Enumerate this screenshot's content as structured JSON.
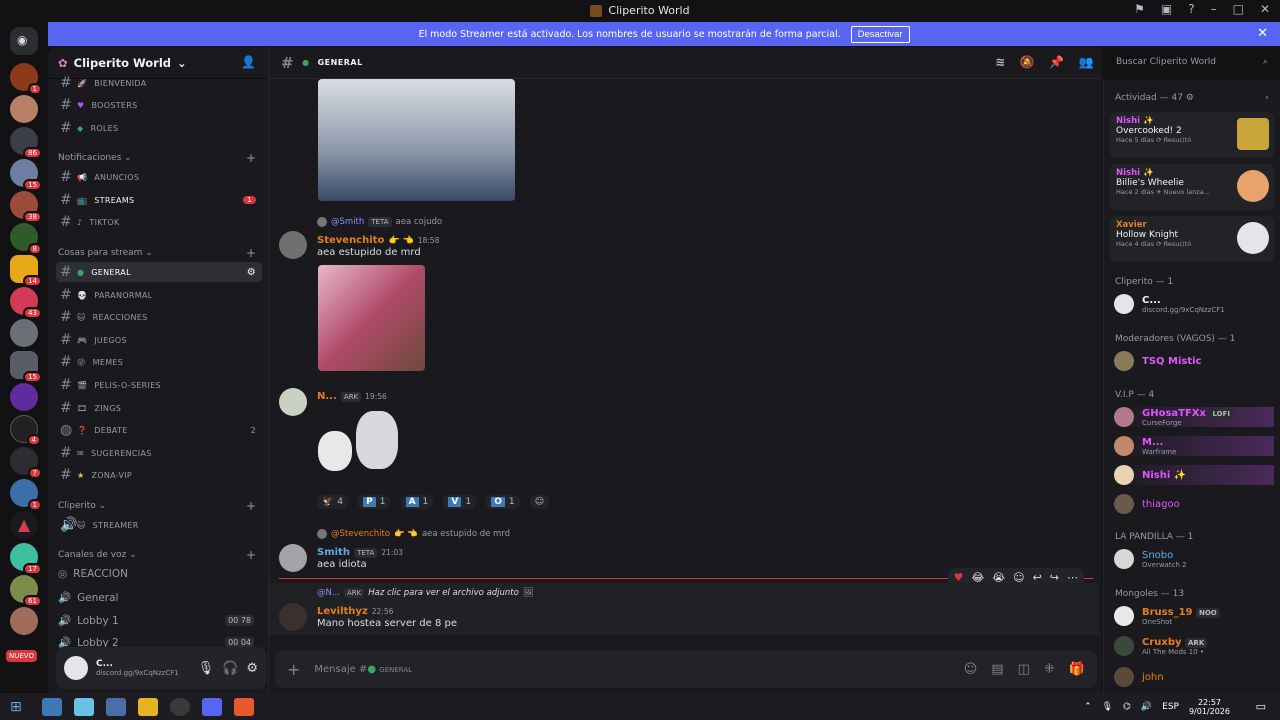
{
  "window": {
    "title": "Cliperito World"
  },
  "banner": {
    "text": "El modo Streamer está activado. Los nombres de usuario se mostrarán de forma parcial.",
    "button": "Desactivar"
  },
  "guilds": {
    "badges": [
      "1",
      "86",
      "15",
      "38",
      "8",
      "14",
      "43",
      "15",
      "4",
      "7",
      "1",
      "17",
      "61"
    ],
    "new_label": "NUEVO"
  },
  "server": {
    "name": "Cliperito World"
  },
  "channels": {
    "top": [
      {
        "name": "BIENVENIDA"
      },
      {
        "name": "BOOSTERS"
      },
      {
        "name": "ROLES"
      }
    ],
    "cat_notif": "Notificaciones",
    "notif": [
      {
        "name": "ANUNCIOS"
      },
      {
        "name": "STREAMS",
        "badge": "1"
      },
      {
        "name": "TIKTOK"
      }
    ],
    "cat_stream": "Cosas para stream",
    "stream": [
      {
        "name": "GENERAL"
      },
      {
        "name": "PARANORMAL"
      },
      {
        "name": "REACCIONES"
      },
      {
        "name": "JUEGOS"
      },
      {
        "name": "MEMES"
      },
      {
        "name": "PELIS-O-SERIES"
      },
      {
        "name": "ZINGS"
      },
      {
        "name": "DEBATE",
        "count": "2"
      },
      {
        "name": "SUGERENCIAS"
      },
      {
        "name": "ZONA-VIP"
      }
    ],
    "cat_cliperito": "Cliperito",
    "cliperito": [
      {
        "name": "STREAMER"
      }
    ],
    "cat_voice": "Canales de voz",
    "voice": [
      {
        "name": "REACCION"
      },
      {
        "name": "General"
      },
      {
        "name": "Lobby 1",
        "a": "00",
        "b": "78"
      },
      {
        "name": "Lobby 2",
        "a": "00",
        "b": "04"
      }
    ]
  },
  "user": {
    "name": "C...",
    "status": "discord.gg/9xCqNzzCF1"
  },
  "chat": {
    "channel": "GENERAL",
    "messages": {
      "m1": {
        "reply_name": "@Smith",
        "reply_tag": "TETA",
        "reply_text": "aea cojudo",
        "name": "Stevenchito",
        "emoji": "👉 👈",
        "time": "18:58",
        "text": "aea estupido de mrd"
      },
      "m2": {
        "name": "N...",
        "tag": "ARK",
        "time": "19:56"
      },
      "reactions": [
        {
          "label": "4"
        },
        {
          "key": "P",
          "label": "1"
        },
        {
          "key": "A",
          "label": "1"
        },
        {
          "key": "V",
          "label": "1"
        },
        {
          "key": "O",
          "label": "1"
        }
      ],
      "m3": {
        "reply_name": "@Stevenchito",
        "reply_emoji": "👉 👈",
        "reply_text": "aea estupido de mrd",
        "name": "Smith",
        "tag": "TETA",
        "time": "21:03",
        "text": "aea idiota"
      },
      "m4": {
        "reply_name": "@N...",
        "reply_tag": "ARK",
        "reply_text": "Haz clic para ver el archivo adjunto",
        "name": "Levilthyz",
        "time": "22:56",
        "text": "Mano hostea server de 8 pe"
      }
    },
    "composer_placeholder": "Mensaje #",
    "composer_channel": "GENERAL"
  },
  "search": {
    "placeholder": "Buscar Cliperito World"
  },
  "members": {
    "activity_title": "Actividad — 47",
    "activities": [
      {
        "user": "Nishi ✨",
        "game": "Overcooked! 2",
        "meta": "Hace 5 días",
        "meta2": "Resucitó"
      },
      {
        "user": "Nishi ✨",
        "game": "Billie's Wheelie",
        "meta": "Hace 2 días",
        "meta2": "Nuevo lanza..."
      },
      {
        "user": "Xavier",
        "game": "Hollow Knight",
        "meta": "Hace 4 días",
        "meta2": "Resucitó"
      }
    ],
    "groups": {
      "cliperito": "Cliperito — 1",
      "mods": "Moderadores (VAGOS) — 1",
      "vip": "V.I.P — 4",
      "pandilla": "LA PANDILLA — 1",
      "mongoles": "Mongoles — 13"
    },
    "list": {
      "c": {
        "name": "C...",
        "sub": "discord.gg/9xCqNzzCF1"
      },
      "tsq": {
        "name": "TSQ Mistic"
      },
      "ghosa": {
        "name": "GHosaTFXx",
        "tag": "LOFI",
        "sub": "CurseForge"
      },
      "m": {
        "name": "M...",
        "sub": "Warframe"
      },
      "nishi": {
        "name": "Nishi ✨"
      },
      "thiagoo": {
        "name": "thiagoo"
      },
      "snobo": {
        "name": "Snobo",
        "sub": "Overwatch 2"
      },
      "bruss": {
        "name": "Bruss_19",
        "tag": "NOO",
        "sub": "OneShot"
      },
      "cruxby": {
        "name": "Cruxby",
        "tag": "ARK",
        "sub": "All The Mods 10 •"
      },
      "john": {
        "name": "john"
      }
    }
  },
  "taskbar": {
    "lang": "ESP",
    "time": "22:57",
    "date": "9/01/2026"
  },
  "colors": {
    "accent": "#5865f2",
    "badge": "#da373c",
    "name_orange": "#e67e22",
    "name_blue": "#5dade2",
    "name_pink": "#e056fd",
    "name_gold": "#f5c542"
  }
}
